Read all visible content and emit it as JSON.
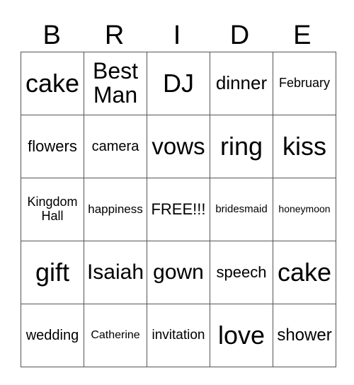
{
  "title_letters": [
    "B",
    "R",
    "I",
    "D",
    "E"
  ],
  "grid": [
    [
      {
        "text": "cake",
        "size": 36
      },
      {
        "text": "Best\nMan",
        "size": 32
      },
      {
        "text": "DJ",
        "size": 36
      },
      {
        "text": "dinner",
        "size": 26
      },
      {
        "text": "February",
        "size": 18
      }
    ],
    [
      {
        "text": "flowers",
        "size": 22
      },
      {
        "text": "camera",
        "size": 20
      },
      {
        "text": "vows",
        "size": 33
      },
      {
        "text": "ring",
        "size": 36
      },
      {
        "text": "kiss",
        "size": 36
      }
    ],
    [
      {
        "text": "Kingdom\nHall",
        "size": 18
      },
      {
        "text": "happiness",
        "size": 17
      },
      {
        "text": "FREE!!!",
        "size": 22
      },
      {
        "text": "bridesmaid",
        "size": 15
      },
      {
        "text": "honeymoon",
        "size": 14
      }
    ],
    [
      {
        "text": "gift",
        "size": 36
      },
      {
        "text": "Isaiah",
        "size": 30
      },
      {
        "text": "gown",
        "size": 30
      },
      {
        "text": "speech",
        "size": 22
      },
      {
        "text": "cake",
        "size": 36
      }
    ],
    [
      {
        "text": "wedding",
        "size": 20
      },
      {
        "text": "Catherine",
        "size": 16
      },
      {
        "text": "invitation",
        "size": 19
      },
      {
        "text": "love",
        "size": 36
      },
      {
        "text": "shower",
        "size": 24
      }
    ]
  ]
}
